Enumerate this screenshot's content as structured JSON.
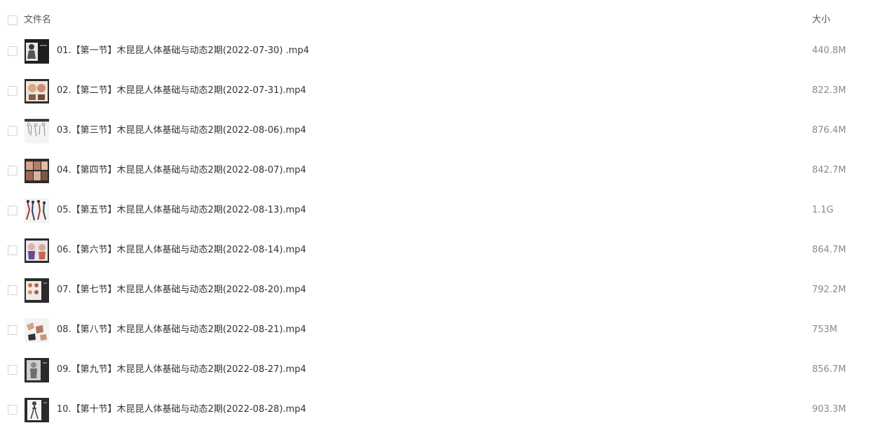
{
  "header": {
    "name_label": "文件名",
    "size_label": "大小"
  },
  "files": [
    {
      "name": "01.【第一节】木昆昆人体基础与动态2期(2022-07-30) .mp4",
      "size": "440.8M"
    },
    {
      "name": "02.【第二节】木昆昆人体基础与动态2期(2022-07-31).mp4",
      "size": "822.3M"
    },
    {
      "name": "03.【第三节】木昆昆人体基础与动态2期(2022-08-06).mp4",
      "size": "876.4M"
    },
    {
      "name": "04.【第四节】木昆昆人体基础与动态2期(2022-08-07).mp4",
      "size": "842.7M"
    },
    {
      "name": "05.【第五节】木昆昆人体基础与动态2期(2022-08-13).mp4",
      "size": "1.1G"
    },
    {
      "name": "06.【第六节】木昆昆人体基础与动态2期(2022-08-14).mp4",
      "size": "864.7M"
    },
    {
      "name": "07.【第七节】木昆昆人体基础与动态2期(2022-08-20).mp4",
      "size": "792.2M"
    },
    {
      "name": "08.【第八节】木昆昆人体基础与动态2期(2022-08-21).mp4",
      "size": "753M"
    },
    {
      "name": "09.【第九节】木昆昆人体基础与动态2期(2022-08-27).mp4",
      "size": "856.7M"
    },
    {
      "name": "10.【第十节】木昆昆人体基础与动态2期(2022-08-28).mp4",
      "size": "903.3M"
    }
  ]
}
